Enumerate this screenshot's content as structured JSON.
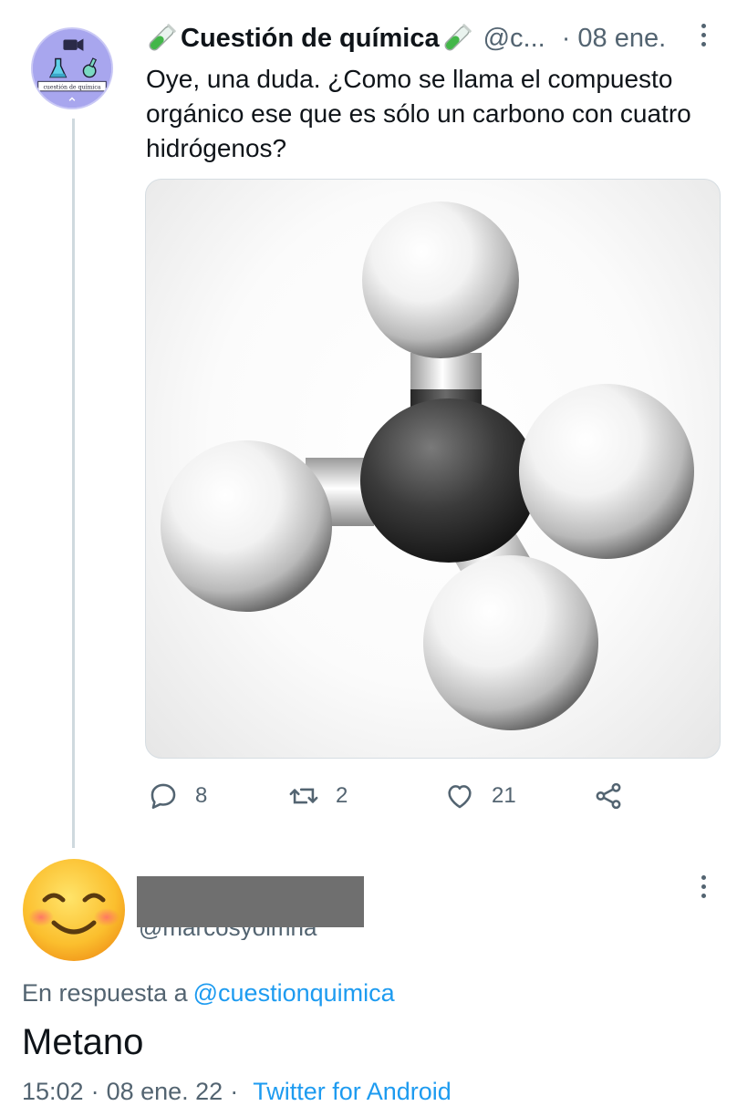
{
  "tweet": {
    "author_display_name": "Cuestión de química",
    "author_handle": "@c...",
    "separator": "·",
    "date": "08 ene.",
    "avatar_caption": "cuestión de química",
    "text": "Oye, una duda. ¿Como se llama el compuesto orgánico ese que es sólo un carbono con cuatro hidrógenos?",
    "media_icon": "methane-molecule-image",
    "stats": {
      "replies": "8",
      "retweets": "2",
      "likes": "21"
    }
  },
  "reply": {
    "avatar_icon": "smiling-face-emoji",
    "handle_fragment": "@marcosyolmna",
    "replying_to_label": "En respuesta a",
    "replying_to_handle": "@cuestionquimica",
    "text": "Metano",
    "time": "15:02",
    "date": "08 ene. 22",
    "separator": "·",
    "source": "Twitter for Android"
  },
  "colors": {
    "link": "#1d9bf0",
    "secondary_text": "#536471",
    "thread_line": "#cfd9de",
    "redaction": "#6f6f6f"
  }
}
